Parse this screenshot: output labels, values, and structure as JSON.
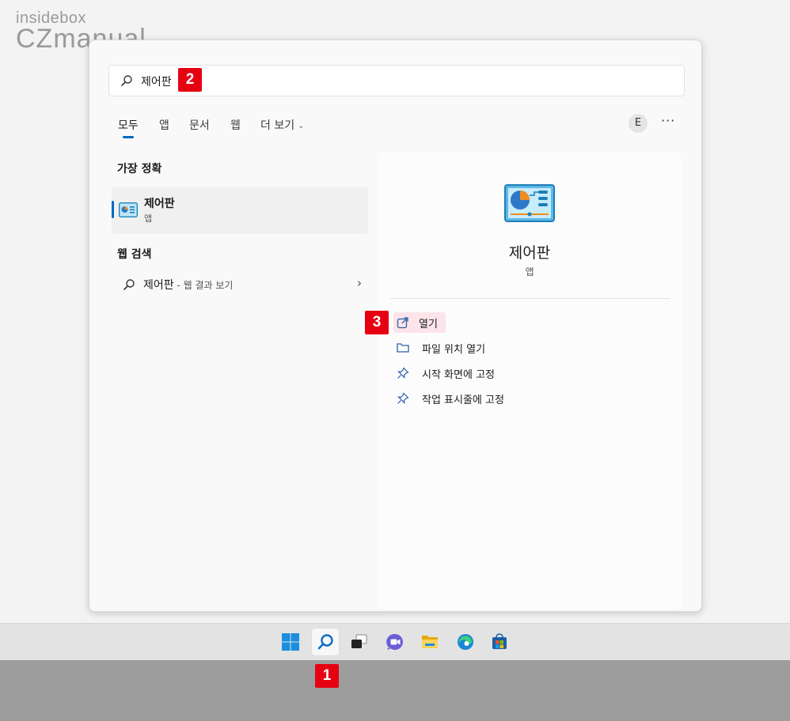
{
  "watermark": {
    "top": "insidebox",
    "bottom": "CZmanual"
  },
  "search": {
    "query": "제어판"
  },
  "tabs": [
    {
      "label": "모두",
      "active": true
    },
    {
      "label": "앱"
    },
    {
      "label": "문서"
    },
    {
      "label": "웹"
    },
    {
      "label": "더 보기"
    }
  ],
  "account_initial": "E",
  "more_label": "···",
  "best_match": {
    "heading": "가장 정확",
    "name": "제어판",
    "type": "앱"
  },
  "web_search": {
    "heading": "웹 검색",
    "query": "제어판",
    "suffix": " - 웹 결과 보기"
  },
  "preview": {
    "name": "제어판",
    "type": "앱",
    "actions": [
      {
        "label": "열기",
        "icon": "open-external-icon"
      },
      {
        "label": "파일 위치 열기",
        "icon": "folder-icon"
      },
      {
        "label": "시작 화면에 고정",
        "icon": "pin-icon"
      },
      {
        "label": "작업 표시줄에 고정",
        "icon": "pin-icon"
      }
    ]
  },
  "markers": [
    "1",
    "2",
    "3"
  ],
  "taskbar": {
    "icons": [
      "windows-start-icon",
      "search-icon",
      "task-view-icon",
      "chat-icon",
      "file-explorer-icon",
      "edge-icon",
      "store-icon"
    ],
    "active": "search-icon"
  },
  "colors": {
    "accent": "#0067c0",
    "marker": "#e60012",
    "highlight": "#fde4ea"
  }
}
